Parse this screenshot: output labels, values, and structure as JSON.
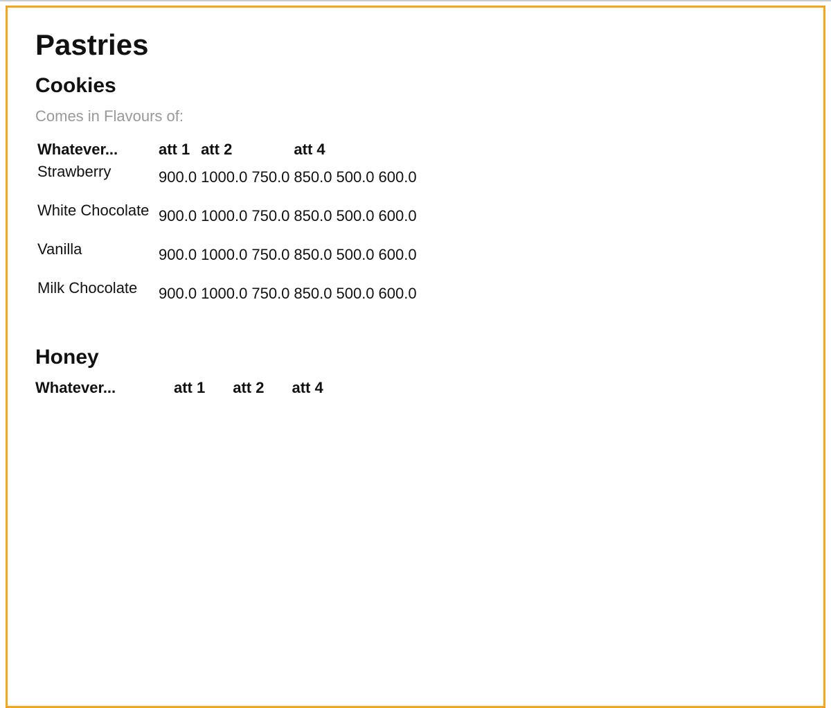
{
  "page": {
    "title": "Pastries"
  },
  "cookies": {
    "heading": "Cookies",
    "subtitle": "Comes in Flavours of:",
    "header_label": "Whatever...",
    "columns": [
      "att 1",
      "att 2",
      "att 4"
    ],
    "rows": [
      {
        "name": "Strawberry",
        "values": [
          "900.0",
          "1000.0",
          "750.0",
          "850.0",
          "500.0",
          "600.0"
        ]
      },
      {
        "name": "White Chocolate",
        "values": [
          "900.0",
          "1000.0",
          "750.0",
          "850.0",
          "500.0",
          "600.0"
        ]
      },
      {
        "name": "Vanilla",
        "values": [
          "900.0",
          "1000.0",
          "750.0",
          "850.0",
          "500.0",
          "600.0"
        ]
      },
      {
        "name": "Milk Chocolate",
        "values": [
          "900.0",
          "1000.0",
          "750.0",
          "850.0",
          "500.0",
          "600.0"
        ]
      }
    ]
  },
  "honey": {
    "heading": "Honey",
    "header_label": "Whatever...",
    "columns": [
      "att 1",
      "att 2",
      "att 4"
    ]
  }
}
